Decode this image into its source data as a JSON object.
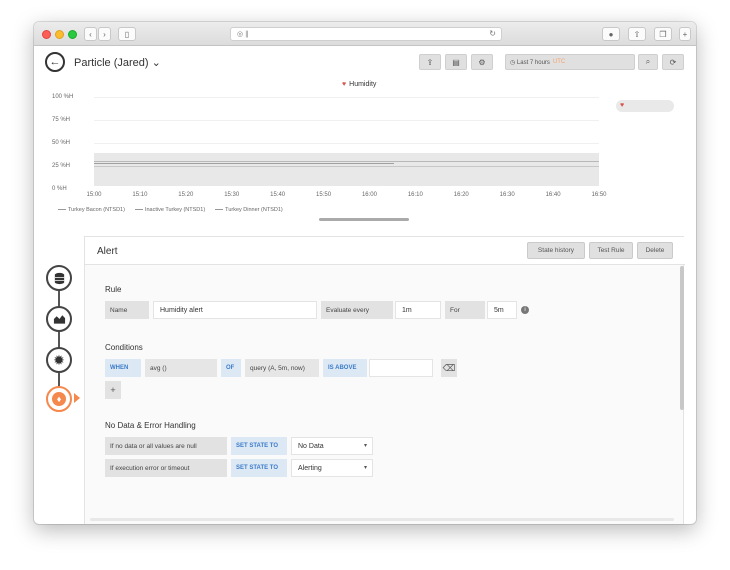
{
  "browser": {
    "url": "◎ ∥"
  },
  "dashboard": {
    "title": "Particle (Jared) ⌄",
    "time_range": "◷ Last 7 hours",
    "timezone": "UTC"
  },
  "graph": {
    "title": "Humidity",
    "y_ticks": [
      "100 %H",
      "75 %H",
      "50 %H",
      "25 %H",
      "0 %H"
    ],
    "x_ticks": [
      "15:00",
      "15:10",
      "15:20",
      "15:30",
      "15:40",
      "15:50",
      "16:00",
      "16:10",
      "16:20",
      "16:30",
      "16:40",
      "16:50"
    ],
    "legend": [
      "Turkey Bacon (NTSD1)",
      "Inactive Turkey (NTSD1)",
      "Turkey Dinner (NTSD1)"
    ],
    "side_legend": "♥"
  },
  "chart_data": {
    "type": "line",
    "title": "Humidity",
    "x": [
      "15:00",
      "15:10",
      "15:20",
      "15:30",
      "15:40",
      "15:50",
      "16:00",
      "16:10",
      "16:20",
      "16:30",
      "16:40",
      "16:50"
    ],
    "ylim": [
      0,
      100
    ],
    "series": [
      {
        "name": "Turkey Bacon (NTSD1)",
        "values": [
          30,
          30,
          30,
          30,
          30,
          30,
          30,
          30,
          30,
          30,
          30,
          30
        ]
      },
      {
        "name": "Inactive Turkey (NTSD1)",
        "values": [
          28,
          28,
          28,
          28,
          28,
          28,
          28,
          28,
          28,
          28,
          28,
          28
        ]
      },
      {
        "name": "Turkey Dinner (NTSD1)",
        "values": [
          25,
          25,
          25,
          25,
          25,
          25,
          25,
          25,
          25,
          25,
          25,
          25
        ]
      }
    ]
  },
  "alert": {
    "title": "Alert",
    "buttons": {
      "state_history": "State history",
      "test_rule": "Test Rule",
      "delete": "Delete"
    },
    "rule": {
      "section": "Rule",
      "name_label": "Name",
      "name_value": "Humidity alert",
      "evaluate_label": "Evaluate every",
      "evaluate_value": "1m",
      "for_label": "For",
      "for_value": "5m"
    },
    "conditions": {
      "section": "Conditions",
      "when": "WHEN",
      "reducer": "avg ()",
      "of": "OF",
      "query": "query (A, 5m, now)",
      "is_above": "IS ABOVE",
      "threshold": "",
      "add": "+"
    },
    "no_data": {
      "section": "No Data & Error Handling",
      "row1_label": "If no data or all values are null",
      "row1_kw": "SET STATE TO",
      "row1_value": "No Data",
      "row2_label": "If execution error or timeout",
      "row2_kw": "SET STATE TO",
      "row2_value": "Alerting"
    }
  },
  "icons": {
    "back": "←",
    "share": "⇪",
    "save": "▤",
    "settings": "⚙",
    "search": "⌕",
    "refresh": "⟳",
    "trash": "🗑",
    "info": "i",
    "caret": "▾"
  },
  "colors": {
    "accent": "#f5884c",
    "keyword": "#3a7bc8",
    "alert_heart": "#d9534f"
  }
}
